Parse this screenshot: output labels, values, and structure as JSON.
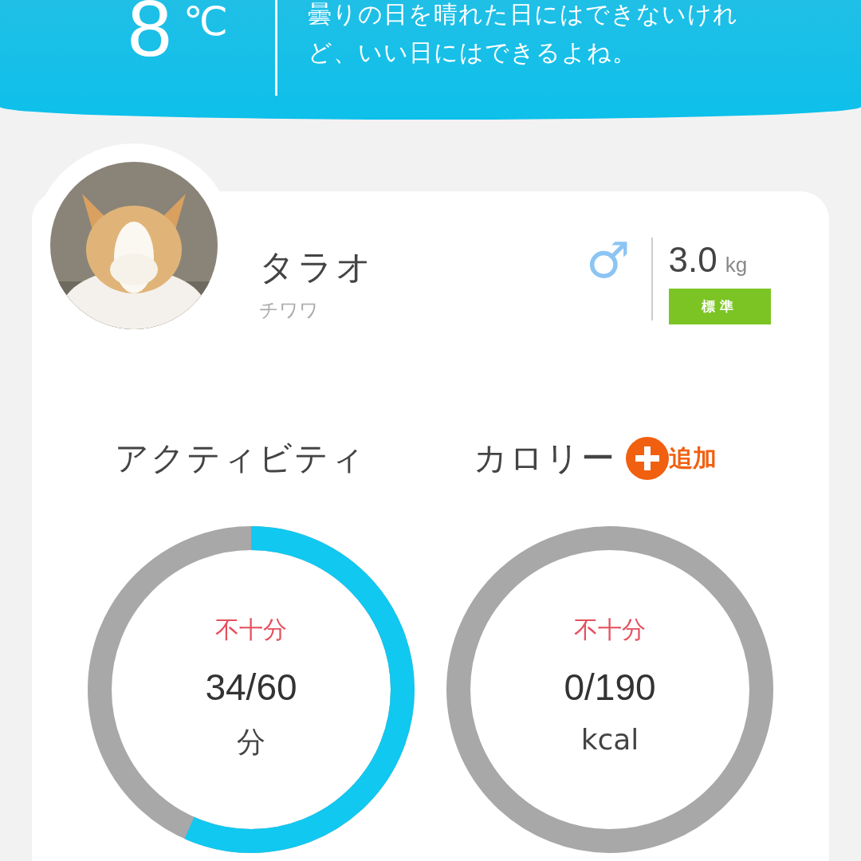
{
  "weather": {
    "temperature": "8",
    "unit": "℃",
    "message": "曇りの日を晴れた日にはできないけれど、いい日にはできるよね。"
  },
  "pet": {
    "name": "タラオ",
    "breed": "チワワ",
    "gender_symbol": "♂",
    "weight": "3.0",
    "weight_unit": "kg",
    "body_status": "標準"
  },
  "sections": [
    {
      "label": "アクティビティ"
    },
    {
      "label": "カロリー",
      "add_button": "追加"
    }
  ],
  "meters": [
    {
      "status": "不十分",
      "reading": "34/60",
      "unit": "分"
    },
    {
      "status": "不十分",
      "reading": "0/190",
      "unit": "kcal"
    }
  ]
}
